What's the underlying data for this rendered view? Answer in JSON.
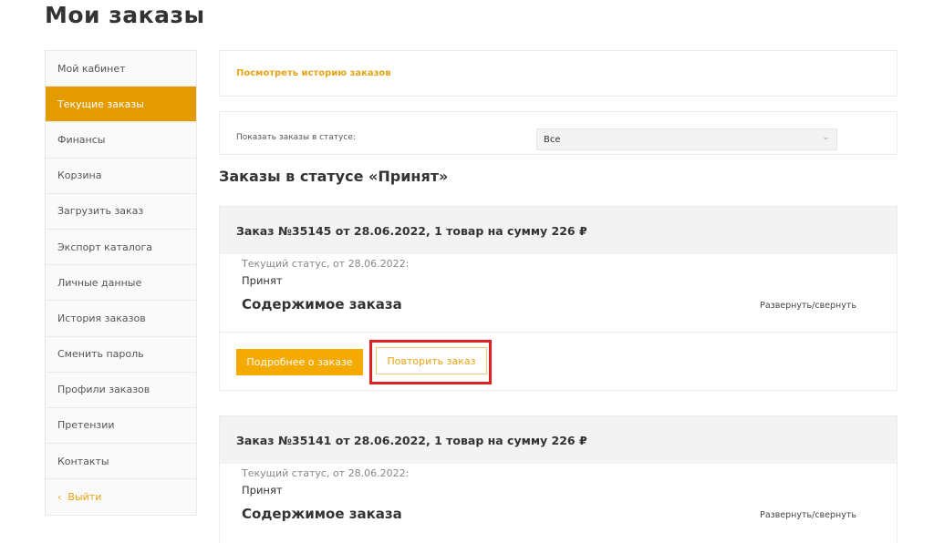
{
  "page": {
    "title": "Мои заказы"
  },
  "sidebar": {
    "items": [
      {
        "label": "Мой кабинет"
      },
      {
        "label": "Текущие заказы"
      },
      {
        "label": "Финансы"
      },
      {
        "label": "Корзина"
      },
      {
        "label": "Загрузить заказ"
      },
      {
        "label": "Экспорт каталога"
      },
      {
        "label": "Личные данные"
      },
      {
        "label": "История заказов"
      },
      {
        "label": "Сменить пароль"
      },
      {
        "label": "Профили заказов"
      },
      {
        "label": "Претензии"
      },
      {
        "label": "Контакты"
      }
    ],
    "active_index": 1,
    "logout": {
      "chevron": "‹",
      "label": "Выйти"
    }
  },
  "history": {
    "link_label": "Посмотреть историю заказов"
  },
  "filter": {
    "label": "Показать заказы в статусе:",
    "selected": "Все",
    "chevron": "⌄"
  },
  "section": {
    "title": "Заказы в статусе «Принят»"
  },
  "orders": [
    {
      "header": "Заказ №35145 от 28.06.2022, 1 товар на сумму 226 ₽",
      "status_label": "Текущий статус, от 28.06.2022:",
      "status_value": "Принят",
      "contents_title": "Содержимое заказа",
      "toggle_label": "Развернуть/свернуть",
      "details_button": "Подробнее о заказе",
      "repeat_button": "Повторить заказ"
    },
    {
      "header": "Заказ №35141 от 28.06.2022, 1 товар на сумму 226 ₽",
      "status_label": "Текущий статус, от 28.06.2022:",
      "status_value": "Принят",
      "contents_title": "Содержимое заказа",
      "toggle_label": "Развернуть/свернуть"
    }
  ],
  "colors": {
    "accent": "#e39b00",
    "button": "#f4aa00",
    "highlight": "#dd2020",
    "link": "#e8a317"
  }
}
